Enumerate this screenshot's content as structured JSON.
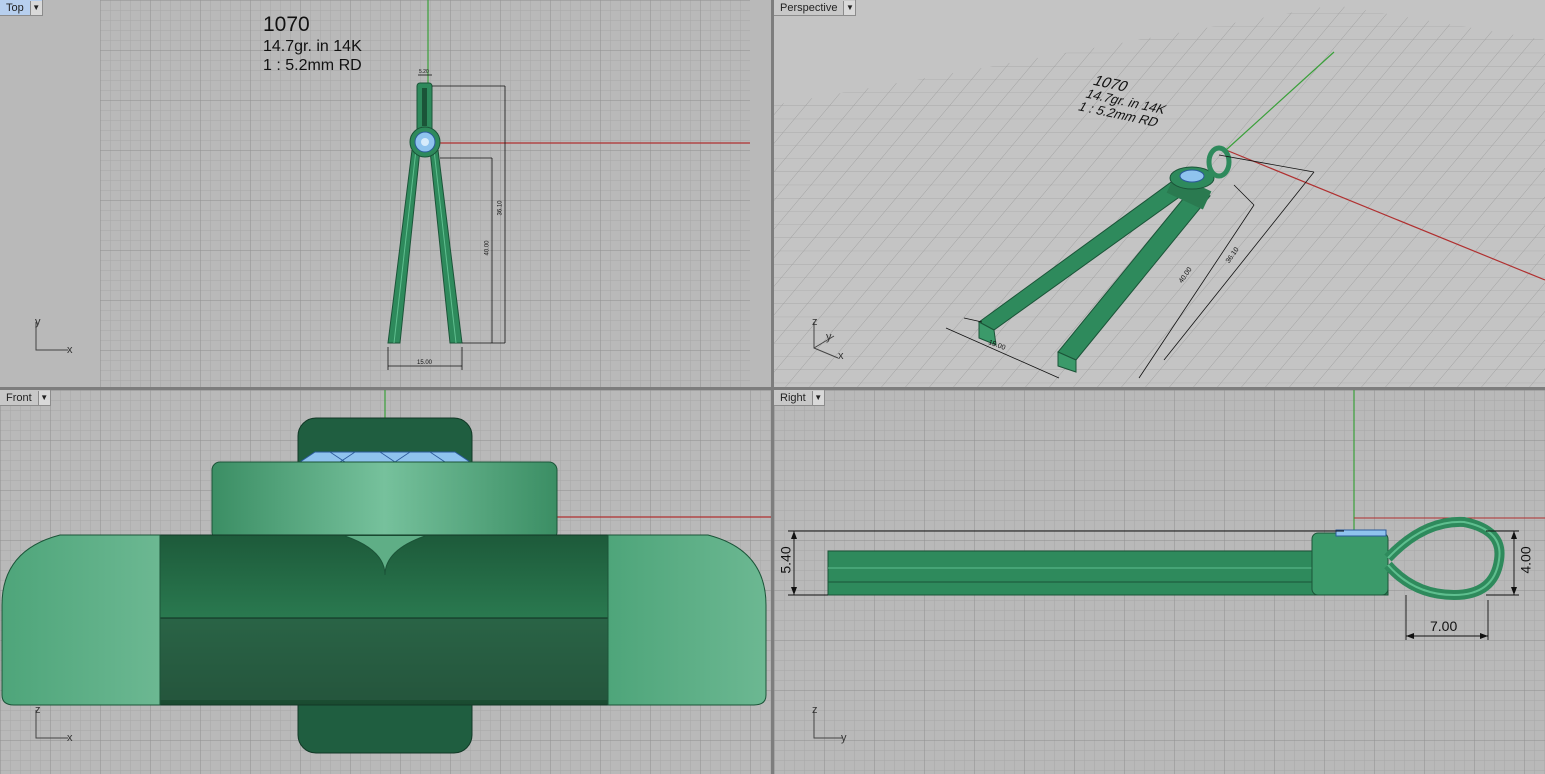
{
  "viewports": {
    "top": {
      "title": "Top",
      "annotation": {
        "line1": "1070",
        "line2": "14.7gr.  in 14K",
        "line3": "1 : 5.2mm RD"
      },
      "dims": {
        "overall": "36.10",
        "inner": "40.00",
        "width": "15.00",
        "top": "5.20"
      },
      "axes": {
        "a": "y",
        "b": "x"
      }
    },
    "perspective": {
      "title": "Perspective",
      "annotation": {
        "line1": "1070",
        "line2": "14.7gr.  in 14K",
        "line3": "1 : 5.2mm RD"
      },
      "dims": {
        "a": "40.00",
        "b": "36.10",
        "c": "15.00"
      },
      "axes": {
        "a": "z",
        "b": "y",
        "c": "x"
      }
    },
    "front": {
      "title": "Front",
      "axes": {
        "a": "z",
        "b": "x"
      }
    },
    "right": {
      "title": "Right",
      "dims": {
        "height": "5.40",
        "loop_height": "4.00",
        "loop_width": "7.00"
      },
      "axes": {
        "a": "z",
        "b": "y"
      }
    }
  },
  "colors": {
    "viewport_bg": "#b9b9b9",
    "grid_minor": "#a9a9a9",
    "grid_major": "#939393",
    "model_green": "#2e8a5c",
    "model_light": "#5fae86",
    "gem_blue": "#8fc3ee",
    "x_axis": "#b03030",
    "y_axis": "#3aa03a",
    "active_tab": "#b7cfee"
  }
}
